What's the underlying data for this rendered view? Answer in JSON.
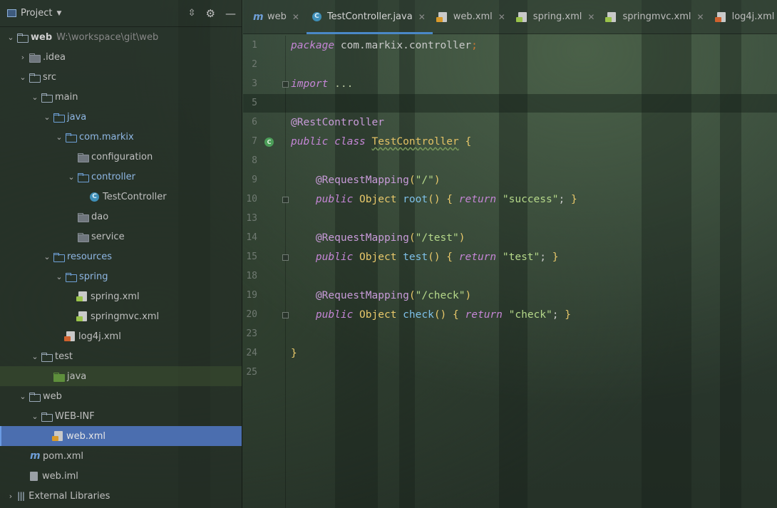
{
  "panel": {
    "title": "Project",
    "project_name": "web",
    "project_path": "W:\\workspace\\git\\web"
  },
  "tree": {
    "idea": ".idea",
    "src": "src",
    "main": "main",
    "java": "java",
    "pkg": "com.markix",
    "configuration": "configuration",
    "controller": "controller",
    "test_controller": "TestController",
    "dao": "dao",
    "service": "service",
    "resources": "resources",
    "spring_dir": "spring",
    "spring_xml": "spring.xml",
    "springmvc_xml": "springmvc.xml",
    "log4j_xml": "log4j.xml",
    "test": "test",
    "test_java": "java",
    "web": "web",
    "web_inf": "WEB-INF",
    "web_xml": "web.xml",
    "pom_xml": "pom.xml",
    "web_iml": "web.iml",
    "external_libraries": "External Libraries"
  },
  "tabs": [
    {
      "label": "web",
      "icon": "maven-icon"
    },
    {
      "label": "TestController.java",
      "icon": "class-icon",
      "active": true
    },
    {
      "label": "web.xml",
      "icon": "web-xml-icon"
    },
    {
      "label": "spring.xml",
      "icon": "spring-xml-icon"
    },
    {
      "label": "springmvc.xml",
      "icon": "spring-xml-icon"
    },
    {
      "label": "log4j.xml",
      "icon": "xml-icon"
    }
  ],
  "line_numbers": [
    "1",
    "2",
    "3",
    "5",
    "6",
    "7",
    "8",
    "9",
    "10",
    "13",
    "14",
    "15",
    "18",
    "19",
    "20",
    "23",
    "24",
    "25"
  ],
  "code": {
    "l1_kw": "package",
    "l1_rest": " com.markix.controller",
    "l1_semi": ";",
    "l3_kw": "import",
    "l3_rest": " ...",
    "l6": "@RestController",
    "l7_kw1": "public",
    "l7_kw2": "class",
    "l7_name": "TestController",
    "l7_brace": "{",
    "m1_ann": "@RequestMapping",
    "m1_arg": "\"/\"",
    "m1_kw": "public",
    "m1_type": "Object",
    "m1_name": "root",
    "m1_ret": "return",
    "m1_val": "\"success\"",
    "m2_ann": "@RequestMapping",
    "m2_arg": "\"/test\"",
    "m2_kw": "public",
    "m2_type": "Object",
    "m2_name": "test",
    "m2_ret": "return",
    "m2_val": "\"test\"",
    "m3_ann": "@RequestMapping",
    "m3_arg": "\"/check\"",
    "m3_kw": "public",
    "m3_type": "Object",
    "m3_name": "check",
    "m3_ret": "return",
    "m3_val": "\"check\"",
    "close_brace": "}"
  },
  "colors": {
    "selection": "#4b6eaf",
    "tab_underline": "#4a88c7",
    "keyword": "#c586d6",
    "string": "#b6d98a",
    "annotation": "#c89bd9",
    "method": "#7ec0e8"
  }
}
